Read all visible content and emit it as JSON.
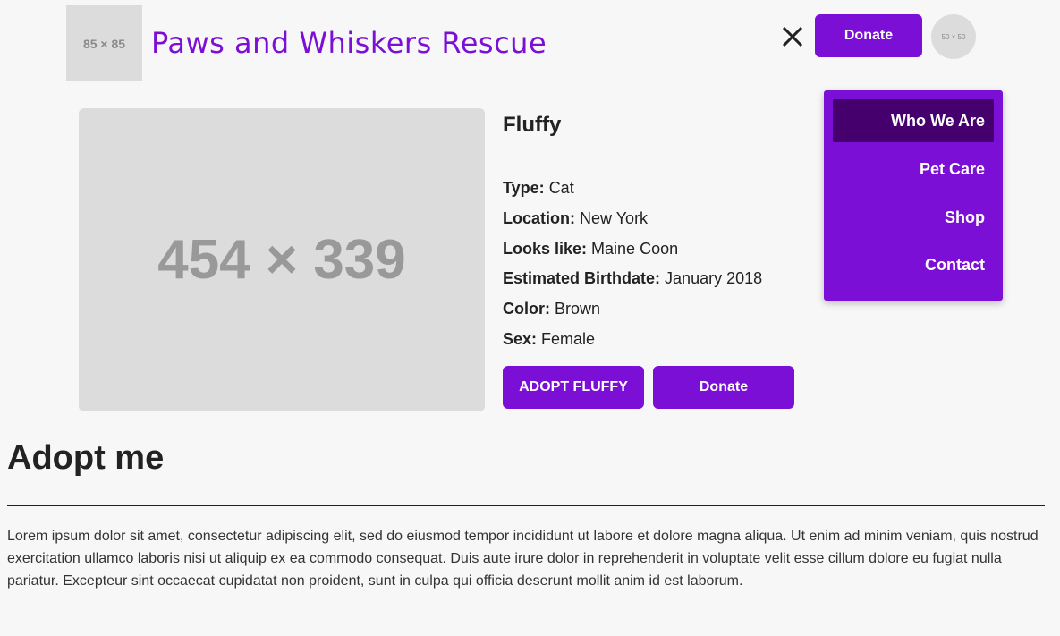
{
  "header": {
    "logo_placeholder": "85 × 85",
    "site_title": "Paws and Whiskers Rescue",
    "close_icon": "close-icon",
    "donate_label": "Donate",
    "avatar_placeholder": "50 × 50"
  },
  "menu": {
    "items": [
      {
        "label": "Who We Are",
        "active": true
      },
      {
        "label": "Pet Care",
        "active": false
      },
      {
        "label": "Shop",
        "active": false
      },
      {
        "label": "Contact",
        "active": false
      }
    ]
  },
  "pet": {
    "image_placeholder": "454 × 339",
    "name": "Fluffy",
    "details": [
      {
        "label": "Type:",
        "value": "Cat"
      },
      {
        "label": "Location:",
        "value": "New York"
      },
      {
        "label": "Looks like:",
        "value": "Maine Coon"
      },
      {
        "label": "Estimated Birthdate:",
        "value": "January 2018"
      },
      {
        "label": "Color:",
        "value": "Brown"
      },
      {
        "label": "Sex:",
        "value": "Female"
      }
    ],
    "adopt_label": "ADOPT FLUFFY",
    "donate_label": "Donate"
  },
  "section": {
    "heading": "Adopt me",
    "body": "Lorem ipsum dolor sit amet, consectetur adipiscing elit, sed do eiusmod tempor incididunt ut labore et dolore magna aliqua. Ut enim ad minim veniam, quis nostrud exercitation ullamco laboris nisi ut aliquip ex ea commodo consequat. Duis aute irure dolor in reprehenderit in voluptate velit esse cillum dolore eu fugiat nulla pariatur. Excepteur sint occaecat cupidatat non proident, sunt in culpa qui officia deserunt mollit anim id est laborum."
  },
  "colors": {
    "accent": "#7b0fd6",
    "accent_dark": "#45006e",
    "background": "#f7f7f7",
    "placeholder": "#dcdcdc"
  }
}
